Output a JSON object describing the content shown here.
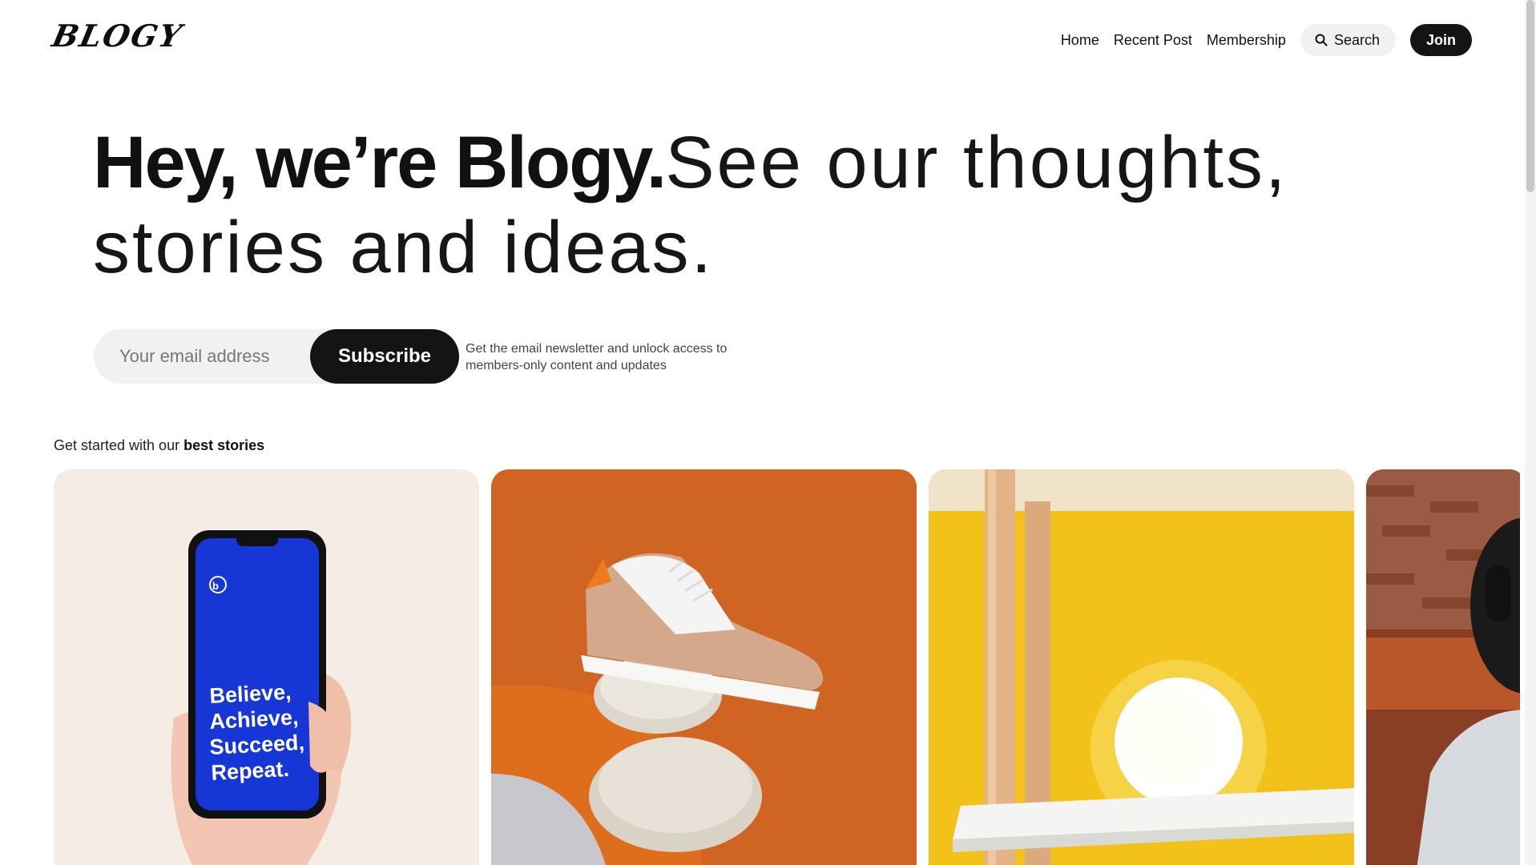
{
  "header": {
    "logo": "BLOGY",
    "nav": [
      {
        "label": "Home"
      },
      {
        "label": "Recent Post"
      },
      {
        "label": "Membership"
      }
    ],
    "search_label": "Search",
    "join_label": "Join"
  },
  "hero": {
    "bold": "Hey, we’re Blogy.",
    "light": "See our thoughts, stories and ideas."
  },
  "subscribe": {
    "placeholder": "Your email address",
    "button": "Subscribe",
    "note": "Get the email newsletter and unlock access to members-only content and updates"
  },
  "best": {
    "prefix": "Get started with our ",
    "emph": "best stories"
  },
  "cards": [
    {
      "phone_text_1": "Believe,",
      "phone_text_2": "Achieve,",
      "phone_text_3": "Succeed,",
      "phone_text_4": "Repeat."
    }
  ],
  "colors": {
    "accent_dark": "#141414",
    "pill_bg": "#f1f1f1",
    "card_orange": "#d9671e",
    "card_yellow": "#f2c21a",
    "phone_blue": "#1736d6"
  }
}
